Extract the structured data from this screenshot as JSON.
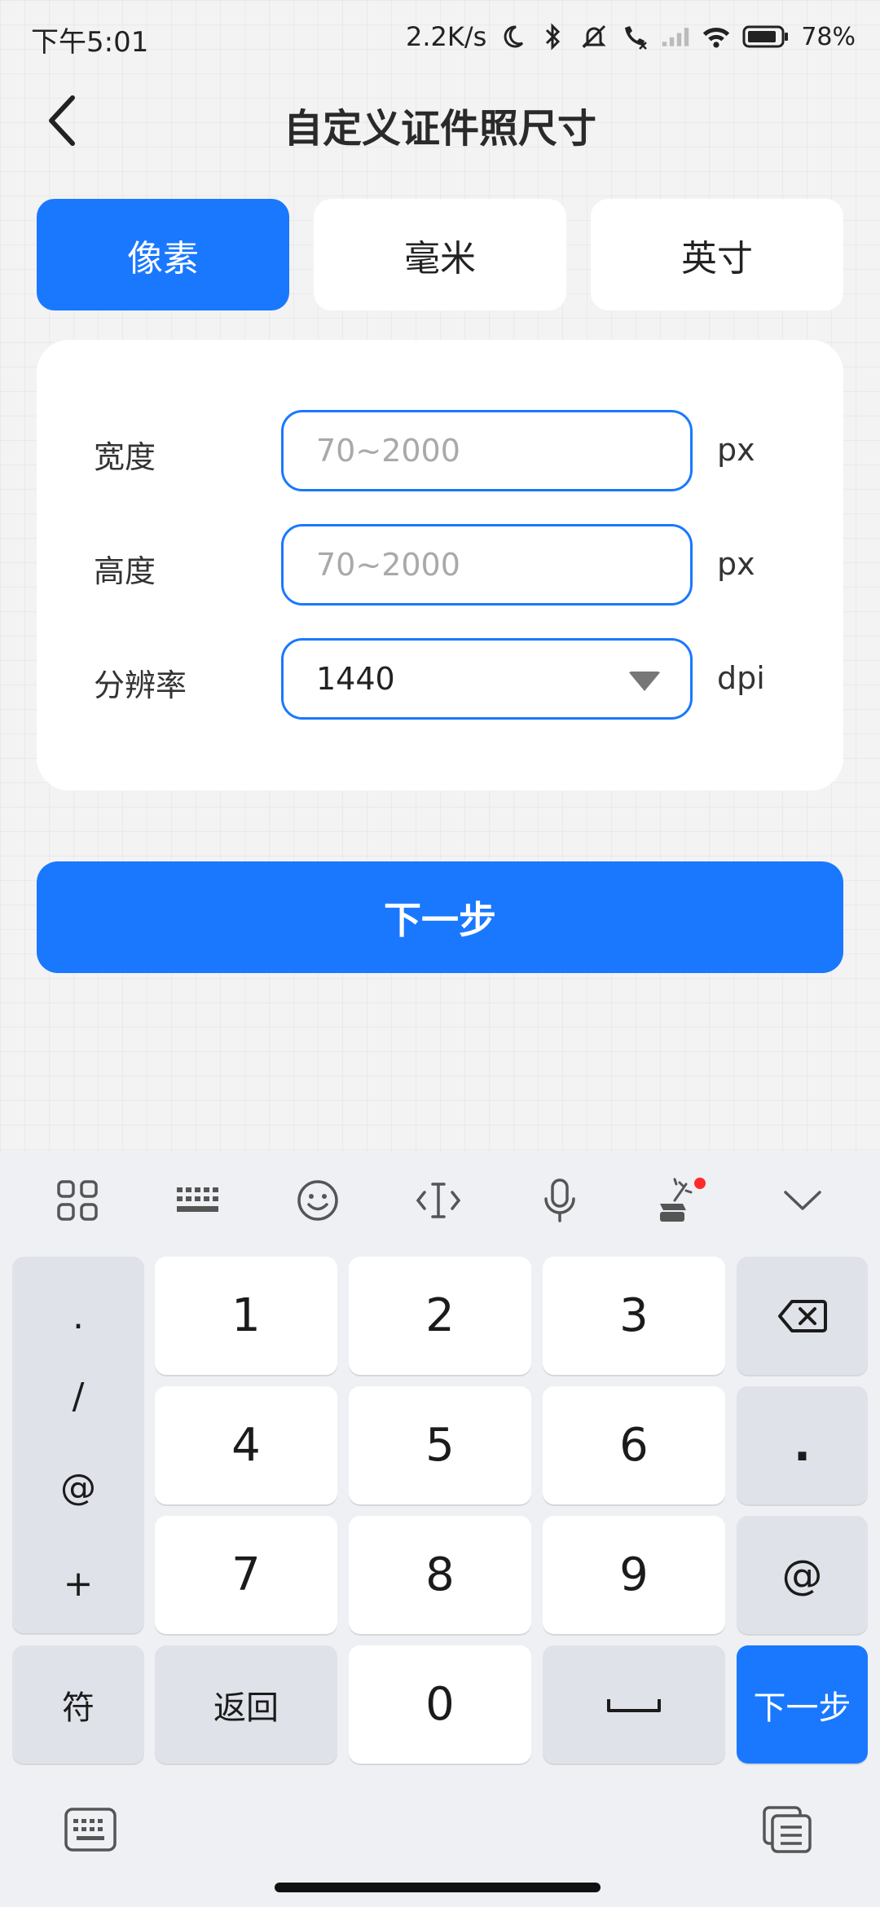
{
  "status_bar": {
    "time": "下午5:01",
    "speed": "2.2K/s",
    "battery_pct": "78%"
  },
  "header": {
    "title": "自定义证件照尺寸"
  },
  "tabs": [
    {
      "label": "像素",
      "active": true
    },
    {
      "label": "毫米",
      "active": false
    },
    {
      "label": "英寸",
      "active": false
    }
  ],
  "form": {
    "width": {
      "label": "宽度",
      "placeholder": "70~2000",
      "value": "",
      "unit": "px"
    },
    "height": {
      "label": "高度",
      "placeholder": "70~2000",
      "value": "",
      "unit": "px"
    },
    "resolution": {
      "label": "分辨率",
      "value": "1440",
      "unit": "dpi"
    }
  },
  "next_button": {
    "label": "下一步"
  },
  "keyboard": {
    "toolbar": [
      "apps-grid-icon",
      "keyboard-layout-icon",
      "emoji-icon",
      "cursor-icon",
      "microphone-icon",
      "magic-icon",
      "collapse-icon"
    ],
    "symbols": [
      ".",
      "/",
      "@",
      "+"
    ],
    "digits": [
      "1",
      "2",
      "3",
      "4",
      "5",
      "6",
      "7",
      "8",
      "9",
      "0"
    ],
    "dot_key": ".",
    "at_key": "@",
    "symbol_key": "符",
    "return_key": "返回",
    "next_key": "下一步"
  },
  "colors": {
    "accent": "#1a78ff",
    "badge": "#ff2a2a"
  }
}
